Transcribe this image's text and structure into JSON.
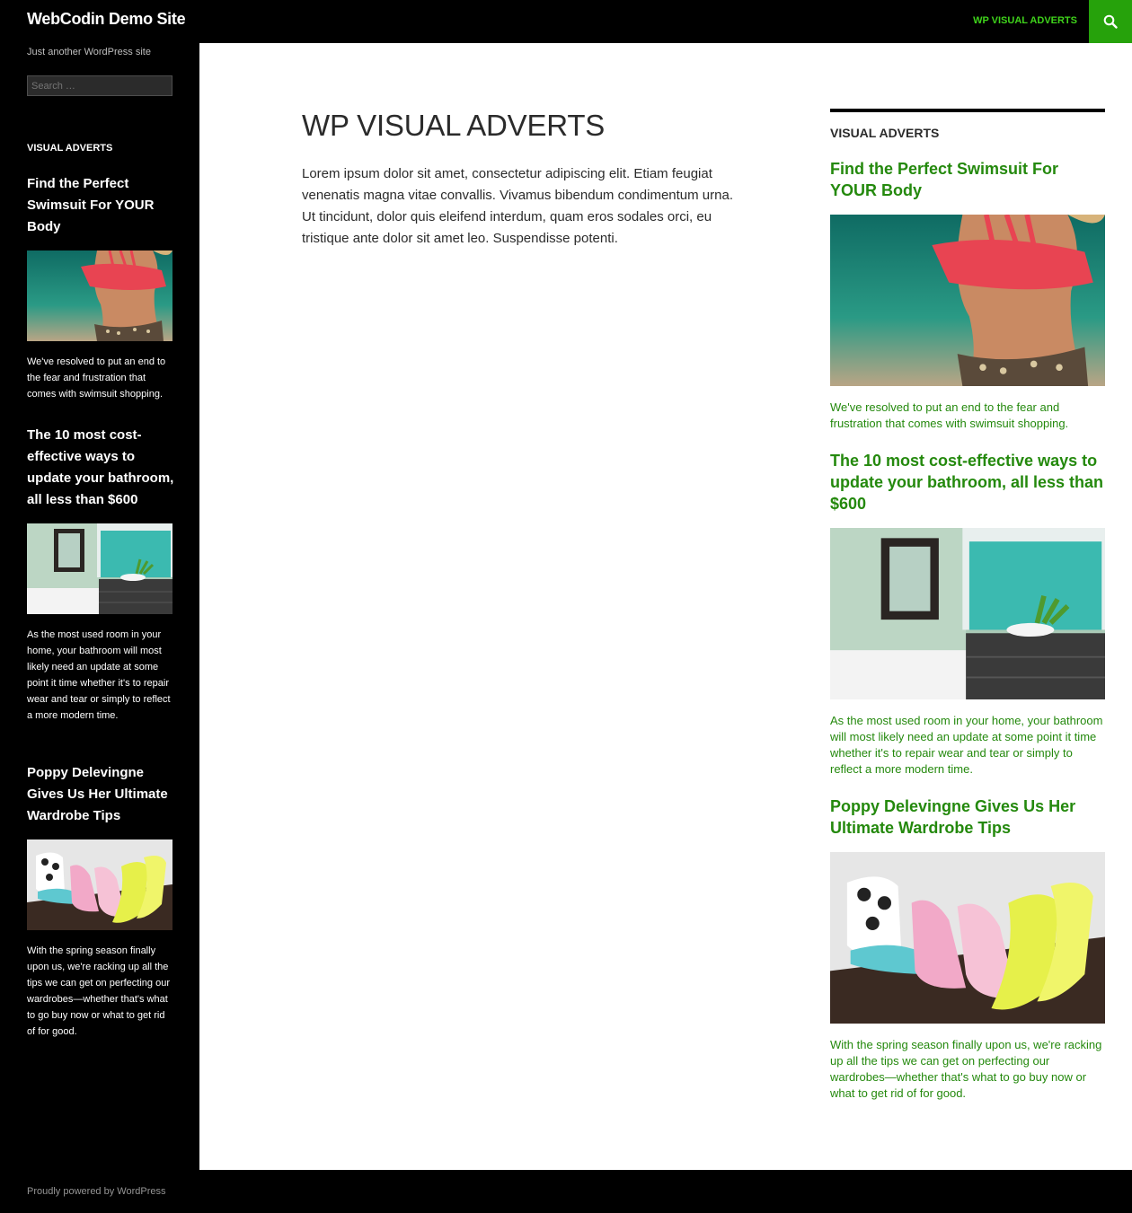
{
  "header": {
    "site_title": "WebCodin Demo Site",
    "nav_item": "WP VISUAL ADVERTS",
    "search_icon": "search-icon"
  },
  "left_sidebar": {
    "description": "Just another WordPress site",
    "search_placeholder": "Search …",
    "widget_title": "VISUAL ADVERTS",
    "ads": [
      {
        "title": "Find the Perfect Swimsuit For YOUR Body",
        "image": "swimsuit-photo",
        "text": "We've resolved to put an end to the fear and frustration that comes with swimsuit shopping."
      },
      {
        "title": "The 10 most cost-effective ways to update your bathroom, all less than $600",
        "image": "bathroom-photo",
        "text": "As the most used room in your home, your bathroom will most likely need an update at some point it time whether it's to repair wear and tear or simply to reflect a more modern time."
      },
      {
        "title": "Poppy Delevingne Gives Us Her Ultimate Wardrobe Tips",
        "image": "shoes-photo",
        "text": "With the spring season finally upon us, we're racking up all the tips we can get on perfecting our wardrobes—whether that's what to go buy now or what to get rid of for good."
      }
    ]
  },
  "main": {
    "title": "WP VISUAL ADVERTS",
    "body": "Lorem ipsum dolor sit amet, consectetur adipiscing elit. Etiam feugiat venenatis magna vitae convallis. Vivamus bibendum condimentum urna. Ut tincidunt, dolor quis eleifend interdum, quam eros sodales orci, eu tristique ante dolor sit amet leo. Suspendisse potenti."
  },
  "right_widget": {
    "widget_title": "VISUAL ADVERTS",
    "ads": [
      {
        "title": "Find the Perfect Swimsuit For YOUR Body",
        "image": "swimsuit-photo",
        "text": "We've resolved to put an end to the fear and frustration that comes with swimsuit shopping."
      },
      {
        "title": "The 10 most cost-effective ways to update your bathroom, all less than $600",
        "image": "bathroom-photo",
        "text": "As the most used room in your home, your bathroom will most likely need an update at some point it time whether it's to repair wear and tear or simply to reflect a more modern time."
      },
      {
        "title": "Poppy Delevingne Gives Us Her Ultimate Wardrobe Tips",
        "image": "shoes-photo",
        "text": "With the spring season finally upon us, we're racking up all the tips we can get on perfecting our wardrobes—whether that's what to go buy now or what to get rid of for good."
      }
    ]
  },
  "footer": {
    "text": "Proudly powered by WordPress"
  },
  "colors": {
    "accent": "#24890d",
    "nav_green": "#3fd31b",
    "search_bg": "#26a20b",
    "dark": "#000000"
  }
}
